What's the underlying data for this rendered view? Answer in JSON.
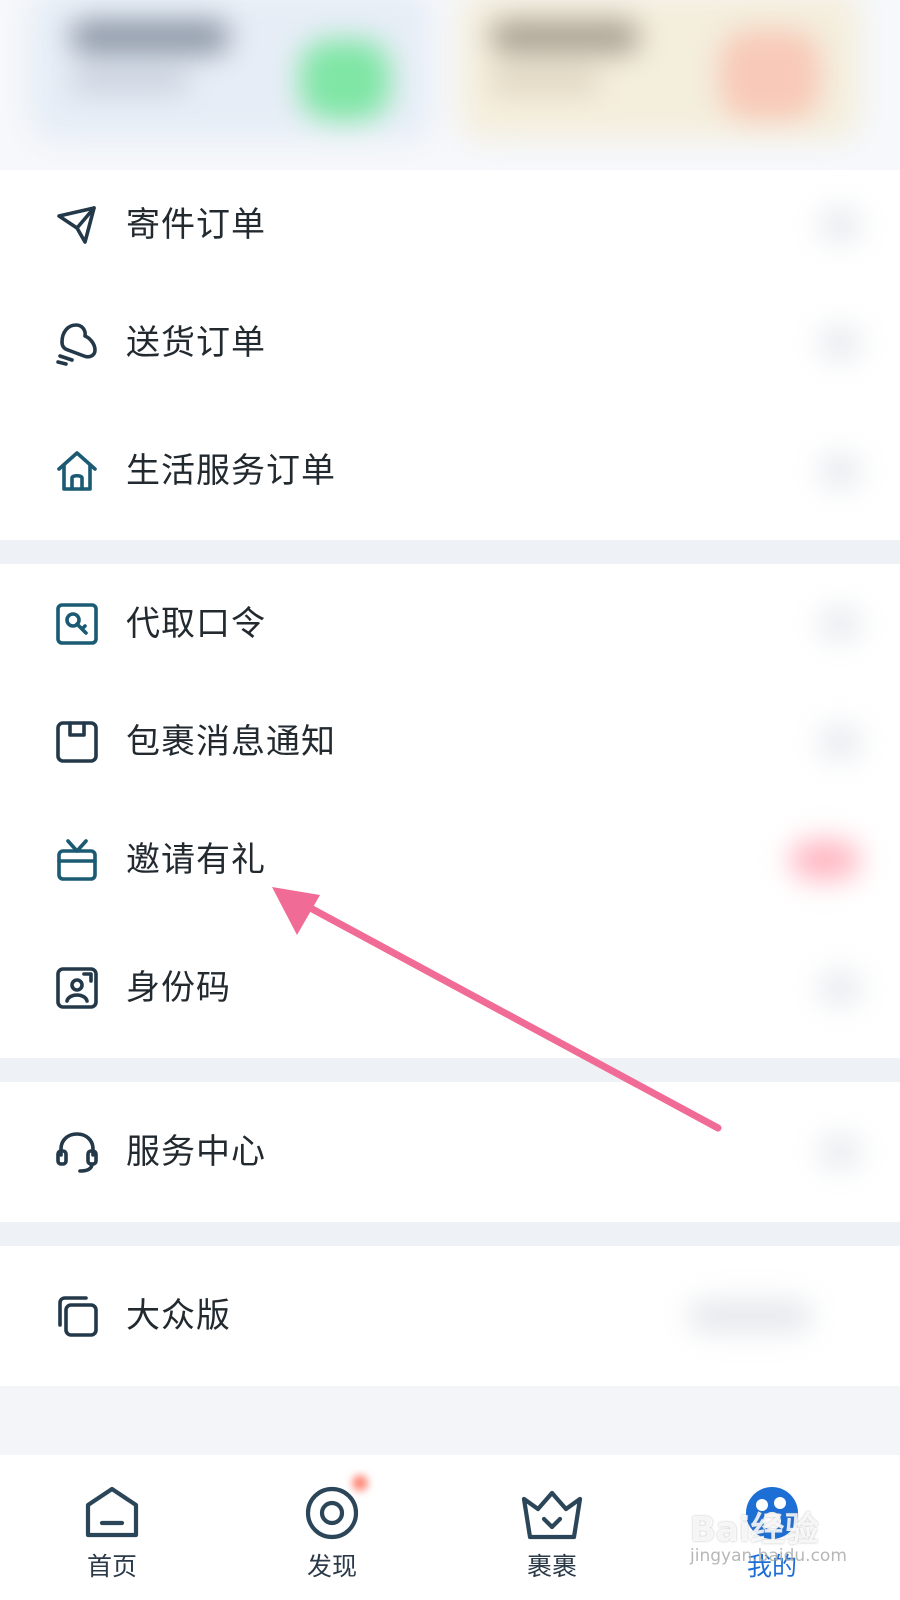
{
  "menu": {
    "group1": [
      {
        "label": "寄件订单",
        "icon": "paper-plane-icon"
      },
      {
        "label": "送货订单",
        "icon": "delivery-bell-icon"
      },
      {
        "label": "生活服务订单",
        "icon": "house-icon"
      }
    ],
    "group2": [
      {
        "label": "代取口令",
        "icon": "key-card-icon"
      },
      {
        "label": "包裹消息通知",
        "icon": "package-icon"
      },
      {
        "label": "邀请有礼",
        "icon": "gift-box-icon"
      },
      {
        "label": "身份码",
        "icon": "id-code-icon"
      }
    ],
    "group3": [
      {
        "label": "服务中心",
        "icon": "headset-icon"
      }
    ],
    "group4": [
      {
        "label": "大众版",
        "icon": "copy-stack-icon"
      }
    ]
  },
  "tabbar": [
    {
      "label": "首页",
      "icon": "home-icon",
      "active": false
    },
    {
      "label": "发现",
      "icon": "discover-icon",
      "active": false
    },
    {
      "label": "裹裹",
      "icon": "crown-icon",
      "active": false
    },
    {
      "label": "我的",
      "icon": "profile-paw-icon",
      "active": true
    }
  ],
  "watermark": {
    "main": "Bai经验",
    "sub": "jingyan.baidu.com"
  },
  "colors": {
    "accent": "#1d6fd6",
    "arrow": "#f06b95",
    "icon_dark": "#23394a",
    "icon_teal": "#1a5a73"
  }
}
